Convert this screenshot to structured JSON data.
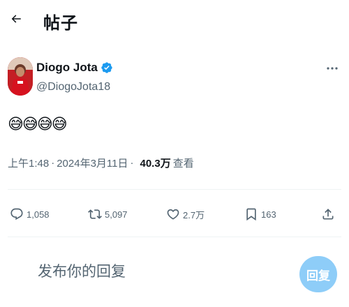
{
  "header": {
    "title": "帖子"
  },
  "author": {
    "name": "Diogo Jota",
    "handle": "@DiogoJota18",
    "verified": true
  },
  "tweet": {
    "text": "😅😅😅😅"
  },
  "meta": {
    "time": "上午1:48",
    "separator": "·",
    "date": "2024年3月11日",
    "views_count": "40.3万",
    "views_label": "查看"
  },
  "actions": {
    "replies": "1,058",
    "retweets": "5,097",
    "likes": "2.7万",
    "bookmarks": "163"
  },
  "reply": {
    "placeholder": "发布你的回复",
    "button_label": "回复"
  },
  "colors": {
    "accent": "#1d9bf0",
    "button_disabled": "#8ecdf8",
    "secondary_text": "#536471",
    "primary_text": "#0f1419"
  },
  "icons": [
    "back-arrow-icon",
    "verified-badge-icon",
    "more-icon",
    "reply-icon",
    "retweet-icon",
    "like-icon",
    "bookmark-icon",
    "share-icon"
  ]
}
